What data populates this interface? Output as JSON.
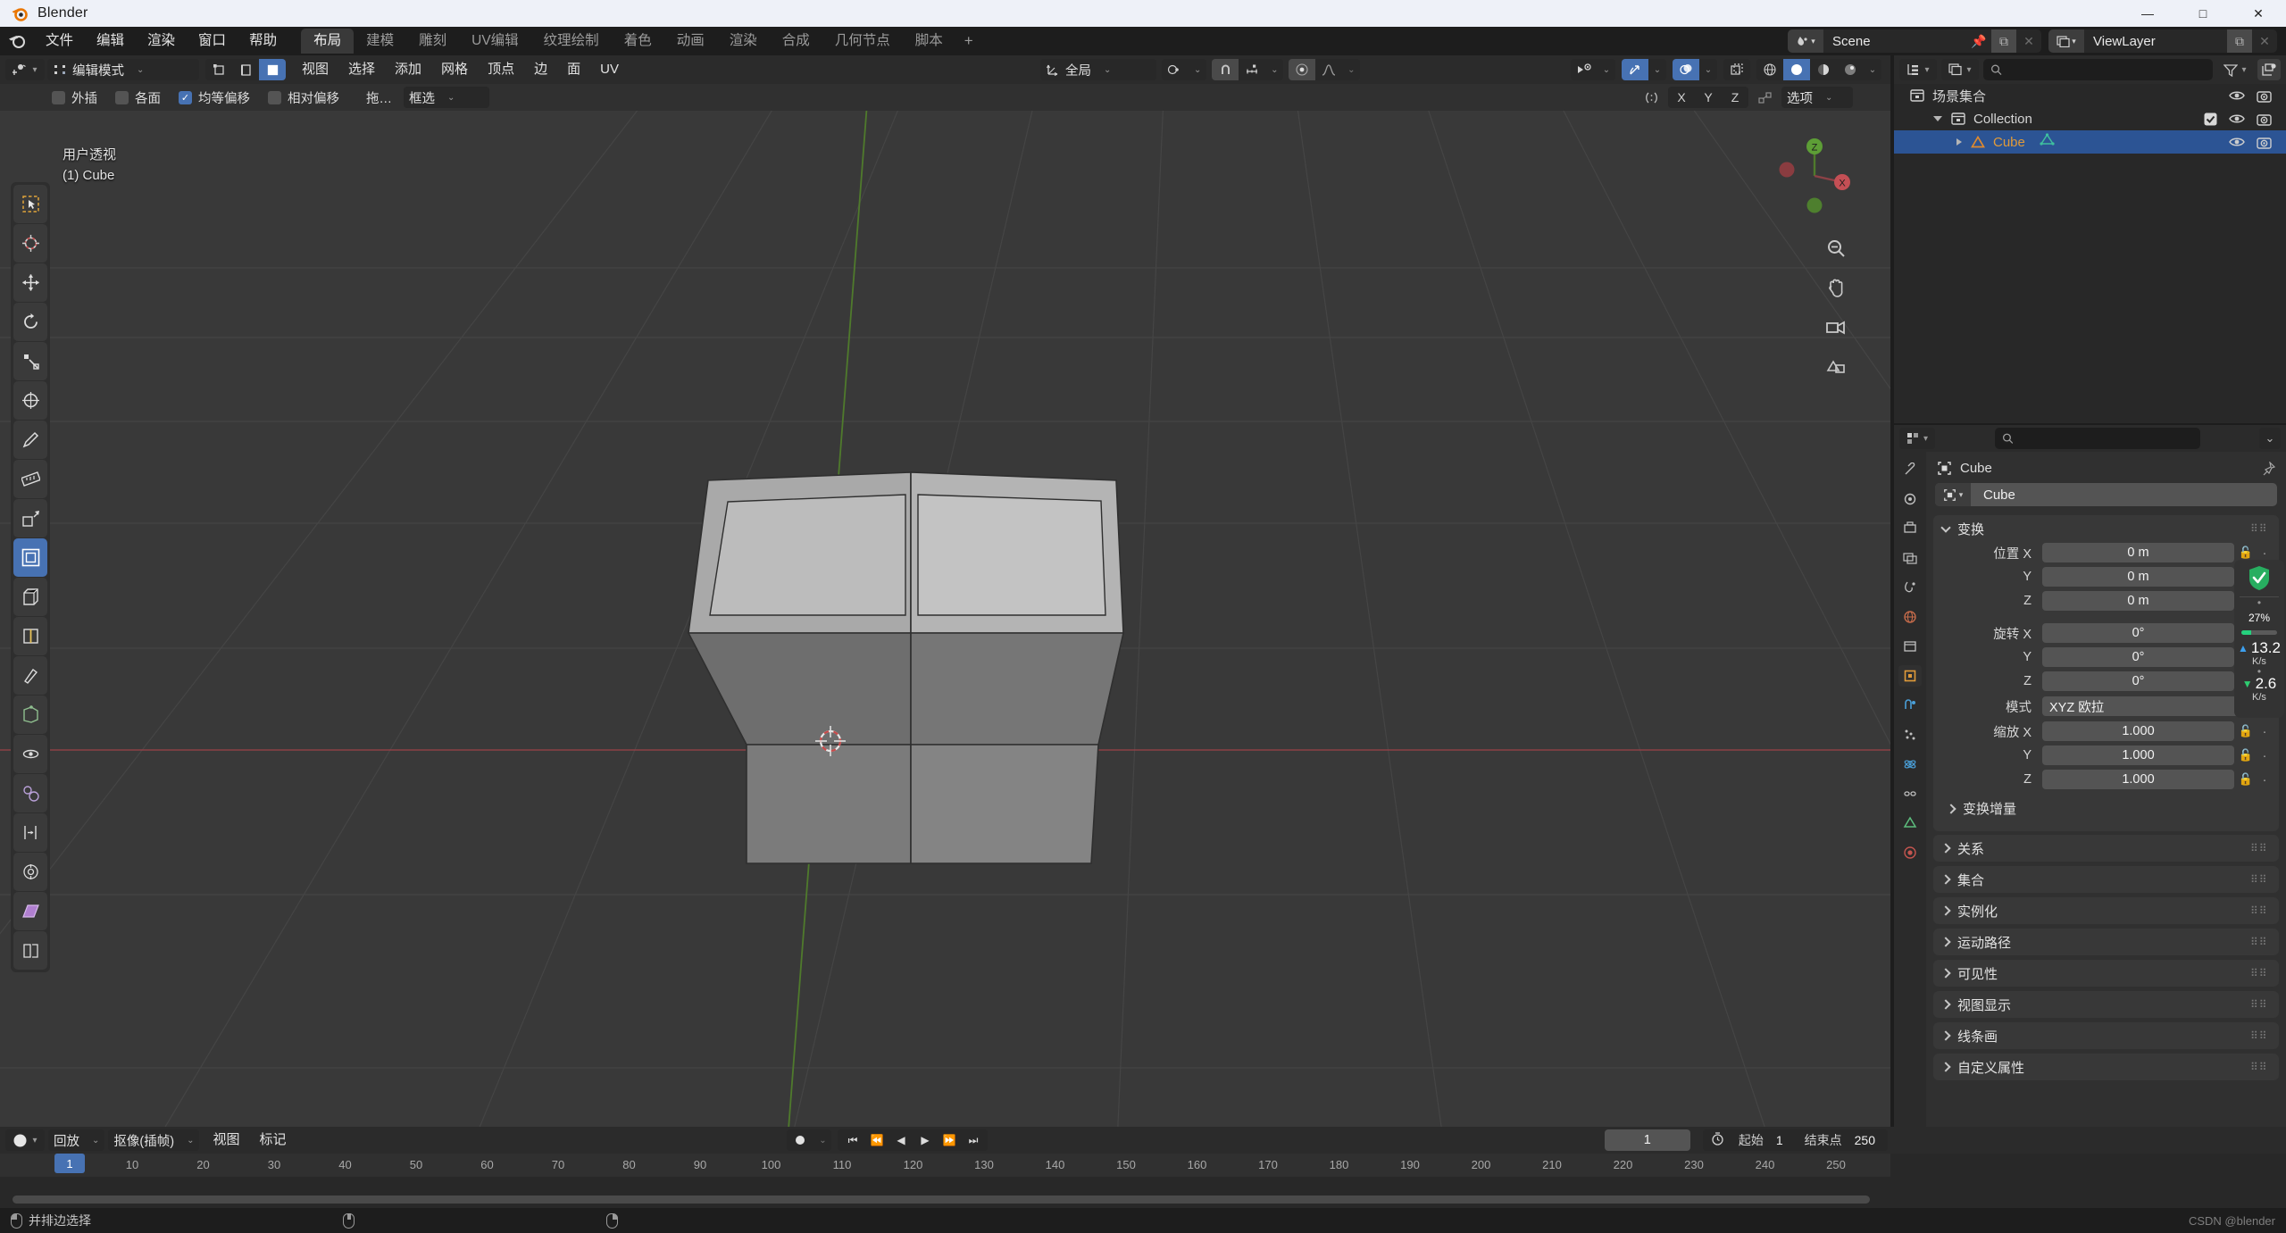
{
  "window": {
    "title": "Blender",
    "buttons": {
      "minimize": "—",
      "maximize": "□",
      "close": "✕"
    }
  },
  "topbar": {
    "menus": [
      "文件",
      "编辑",
      "渲染",
      "窗口",
      "帮助"
    ],
    "workspaces": [
      "布局",
      "建模",
      "雕刻",
      "UV编辑",
      "纹理绘制",
      "着色",
      "动画",
      "渲染",
      "合成",
      "几何节点",
      "脚本"
    ],
    "active_workspace": "布局",
    "add_workspace": "+",
    "scene": {
      "name": "Scene",
      "label": "Scene"
    },
    "viewlayer": {
      "name": "ViewLayer",
      "label": "ViewLayer"
    }
  },
  "viewport": {
    "mode": "编辑模式",
    "menus": [
      "视图",
      "选择",
      "添加",
      "网格",
      "顶点",
      "边",
      "面",
      "UV"
    ],
    "transform_orientation": "全局",
    "overlay_view": "用户透视",
    "overlay_object": "(1) Cube",
    "gizmo_axes": {
      "z": "Z",
      "x": "X"
    },
    "operator_panel": {
      "options": [
        {
          "label": "外插",
          "checked": false
        },
        {
          "label": "各面",
          "checked": false
        },
        {
          "label": "均等偏移",
          "checked": true
        },
        {
          "label": "相对偏移",
          "checked": false
        }
      ],
      "drag_label": "拖…",
      "select_mode": "框选",
      "mirror_axes": [
        "X",
        "Y",
        "Z"
      ],
      "options_label": "选项"
    },
    "select_modes": [
      "顶点",
      "边",
      "面"
    ],
    "active_select_mode": "面",
    "tools": [
      "tweak-tool",
      "cursor-tool",
      "move-tool",
      "rotate-tool",
      "scale-tool",
      "transform-tool",
      "annotate-tool",
      "measure-tool",
      "extrude-tool",
      "inset-tool",
      "bevel-tool",
      "loopcut-tool",
      "knife-tool",
      "poly-build-tool",
      "spin-tool",
      "smooth-tool",
      "edge-slide-tool",
      "shrink-fatten-tool",
      "shear-tool",
      "rip-region-tool"
    ],
    "active_tool": "inset-tool"
  },
  "outliner": {
    "search_placeholder": "",
    "rows": [
      {
        "label": "场景集合",
        "indent": 0,
        "type": "collection",
        "selected": false,
        "expandable": false
      },
      {
        "label": "Collection",
        "indent": 1,
        "type": "collection",
        "selected": false,
        "expandable": true,
        "checkbox": true
      },
      {
        "label": "Cube",
        "indent": 2,
        "type": "mesh",
        "selected": true,
        "expandable": true
      }
    ]
  },
  "properties": {
    "breadcrumb": "Cube",
    "id_name": "Cube",
    "panels": [
      {
        "label": "变换",
        "open": true
      },
      {
        "label": "关系",
        "open": false
      },
      {
        "label": "集合",
        "open": false
      },
      {
        "label": "实例化",
        "open": false
      },
      {
        "label": "运动路径",
        "open": false
      },
      {
        "label": "可见性",
        "open": false
      },
      {
        "label": "视图显示",
        "open": false
      },
      {
        "label": "线条画",
        "open": false
      },
      {
        "label": "自定义属性",
        "open": false
      }
    ],
    "transform": {
      "location_label": "位置",
      "rotation_label": "旋转",
      "scale_label": "缩放",
      "mode_label": "模式",
      "mode_value": "XYZ 欧拉",
      "delta_label": "变换增量",
      "location": {
        "x": "0 m",
        "y": "0 m",
        "z": "0 m"
      },
      "rotation": {
        "x": "0°",
        "y": "0°",
        "z": "0°"
      },
      "scale": {
        "x": "1.000",
        "y": "1.000",
        "z": "1.000"
      },
      "axis": {
        "x": "X",
        "y": "Y",
        "z": "Z"
      }
    }
  },
  "netwidget": {
    "cpu_percent": "27",
    "percent_sign": "%",
    "upload": "13.2",
    "upload_unit": "K/s",
    "download": "2.6",
    "download_unit": "K/s"
  },
  "timeline": {
    "menus": [
      "回放",
      "抠像(插帧)",
      "视图",
      "标记"
    ],
    "current_frame": "1",
    "start_label": "起始",
    "start_value": "1",
    "end_label": "结束点",
    "end_value": "250",
    "ticks": [
      "10",
      "20",
      "30",
      "40",
      "50",
      "60",
      "70",
      "80",
      "90",
      "100",
      "110",
      "120",
      "130",
      "140",
      "150",
      "160",
      "170",
      "180",
      "190",
      "200",
      "210",
      "220",
      "230",
      "240",
      "250"
    ],
    "playhead_frame": "1"
  },
  "statusbar": {
    "hint1": "并排边选择",
    "watermark": "CSDN @blender"
  }
}
